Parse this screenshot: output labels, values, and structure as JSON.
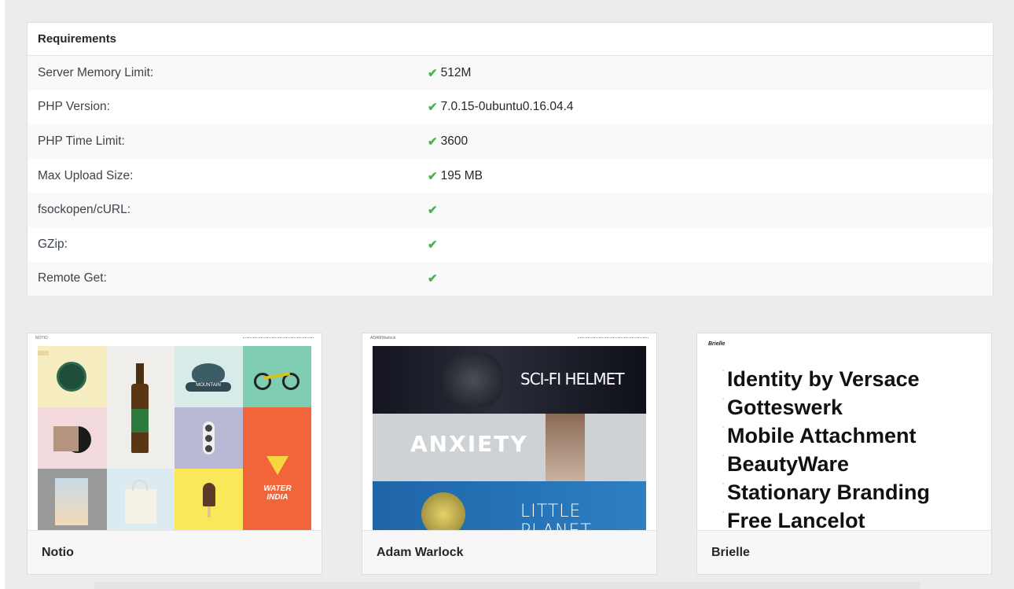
{
  "requirements": {
    "title": "Requirements",
    "rows": [
      {
        "label": "Server Memory Limit:",
        "value": "512M"
      },
      {
        "label": "PHP Version:",
        "value": "7.0.15-0ubuntu0.16.04.4"
      },
      {
        "label": "PHP Time Limit:",
        "value": "3600"
      },
      {
        "label": "Max Upload Size:",
        "value": "195 MB"
      },
      {
        "label": "fsockopen/cURL:",
        "value": ""
      },
      {
        "label": "GZip:",
        "value": ""
      },
      {
        "label": "Remote Get:",
        "value": ""
      }
    ],
    "check_glyph": "✔",
    "check_color": "#46b450"
  },
  "themes": [
    {
      "name": "Notio",
      "nav_brand": "NOTIO"
    },
    {
      "name": "Adam Warlock",
      "nav_brand": "ADAMWarlock",
      "bands": [
        "SCI-FI HELMET",
        "ANXIETY",
        "LITTLE PLANET"
      ]
    },
    {
      "name": "Brielle",
      "nav_brand": "Brielle",
      "items": [
        "Identity by Versace",
        "Gotteswerk",
        "Mobile Attachment",
        "BeautyWare",
        "Stationary Branding",
        "Free Lancelot"
      ]
    }
  ],
  "notio_artwork": {
    "water_text": "WATER INDIA",
    "mountain_text": "MOUNTAIN"
  }
}
